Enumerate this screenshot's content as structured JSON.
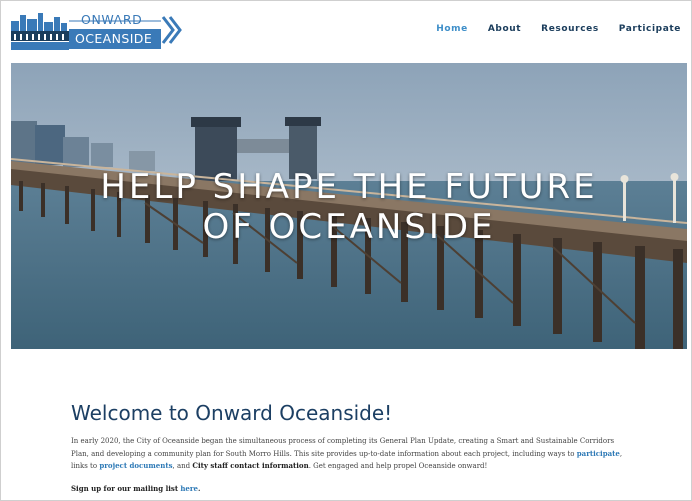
{
  "brand": {
    "line1": "ONWARD",
    "line2": "OCEANSIDE",
    "colors": {
      "blue": "#3a7ab8",
      "navy": "#1b3d5c",
      "link": "#3f8fc9"
    }
  },
  "nav": [
    {
      "label": "Home",
      "active": true
    },
    {
      "label": "About",
      "active": false
    },
    {
      "label": "Resources",
      "active": false
    },
    {
      "label": "Participate",
      "active": false
    }
  ],
  "hero": {
    "title_line1": "HELP SHAPE THE FUTURE",
    "title_line2": "OF OCEANSIDE",
    "image": "oceanside-pier-photo"
  },
  "welcome": {
    "heading": "Welcome to Onward Oceanside!",
    "intro": "In early 2020, the City of Oceanside began the simultaneous process of completing its General Plan Update, creating a Smart and Sustainable Corridors Plan, and developing a community plan for South Morro Hills. This site provides up-to-date information about each project, including ways to",
    "link_participate": "participate",
    "sep1": ", links to",
    "link_documents": "project documents",
    "sep2": ", and",
    "contact": "City staff contact information",
    "closing": ". Get engaged and help propel Oceanside onward!",
    "signup_text": "Sign up for our mailing list",
    "signup_link": "here",
    "signup_end": "."
  }
}
